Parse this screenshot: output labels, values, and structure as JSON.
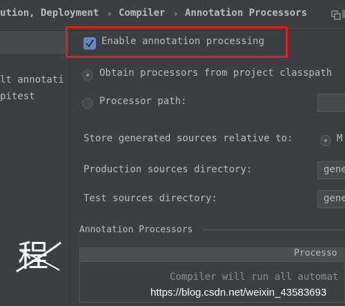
{
  "breadcrumb": {
    "items": [
      "ution, Deployment",
      "Compiler",
      "Annotation Processors"
    ],
    "separator": "›"
  },
  "sidebar": {
    "items": [
      {
        "label": "lt annotati"
      },
      {
        "label": "pitest"
      }
    ],
    "watermark_char": "程"
  },
  "settings": {
    "enable_annotation_processing": {
      "label": "Enable annotation processing",
      "checked": true
    },
    "obtain_from_classpath": {
      "label": "Obtain processors from project classpath",
      "selected": true
    },
    "processor_path": {
      "label": "Processor path:",
      "selected": false
    },
    "store_generated_relative_to": {
      "label": "Store generated sources relative to:",
      "option_visible": "M"
    },
    "production_sources_directory": {
      "label": "Production sources directory:",
      "value": "gene"
    },
    "test_sources_directory": {
      "label": "Test sources directory:",
      "value": "gene"
    }
  },
  "annotation_processors": {
    "section_title": "Annotation Processors",
    "column_header": "Processo",
    "empty_text": "Compiler will run all automat"
  },
  "watermark_url": "https://blog.csdn.net/weixin_43583693",
  "colors": {
    "accent_checkbox": "#5d88bf",
    "highlight_border": "#e02020"
  }
}
